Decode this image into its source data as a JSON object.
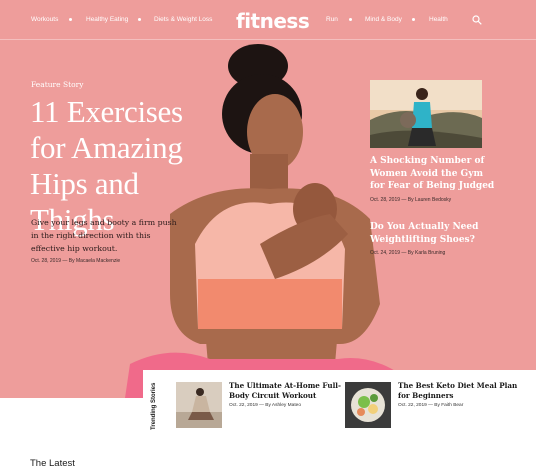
{
  "brand": {
    "logo": "fitness",
    "accent": "#ee9d9b"
  },
  "nav": {
    "left": [
      "Workouts",
      "Healthy Eating",
      "Diets & Weight Loss"
    ],
    "right": [
      "Run",
      "Mind & Body",
      "Health"
    ],
    "search_icon": "search-icon"
  },
  "feature": {
    "kicker": "Feature Story",
    "title": "11 Exercises for Amazing Hips and Thighs",
    "dek": "Give your legs and booty a firm push in the right direction with this effective hip workout.",
    "byline": "Oct. 28, 2019 — By Macaela Mackenzie"
  },
  "sidebar": [
    {
      "title": "A Shocking Number of Women Avoid the Gym for Fear of Being Judged",
      "byline": "Oct. 28, 2019 — By Lauren Bedosky"
    },
    {
      "title": "Do You Actually Need Weightlifting Shoes?",
      "byline": "Oct. 24, 2019 — By Karla Bruning"
    }
  ],
  "trending": {
    "label": "Trending Stories",
    "items": [
      {
        "title": "The Ultimate At-Home Full-Body Circuit Workout",
        "byline": "Oct. 22, 2019 — By Ashley Mateo"
      },
      {
        "title": "The Best Keto Diet Meal Plan for Beginners",
        "byline": "Oct. 22, 2019 — By Faith Bear"
      }
    ]
  },
  "latest": {
    "heading": "The Latest"
  }
}
